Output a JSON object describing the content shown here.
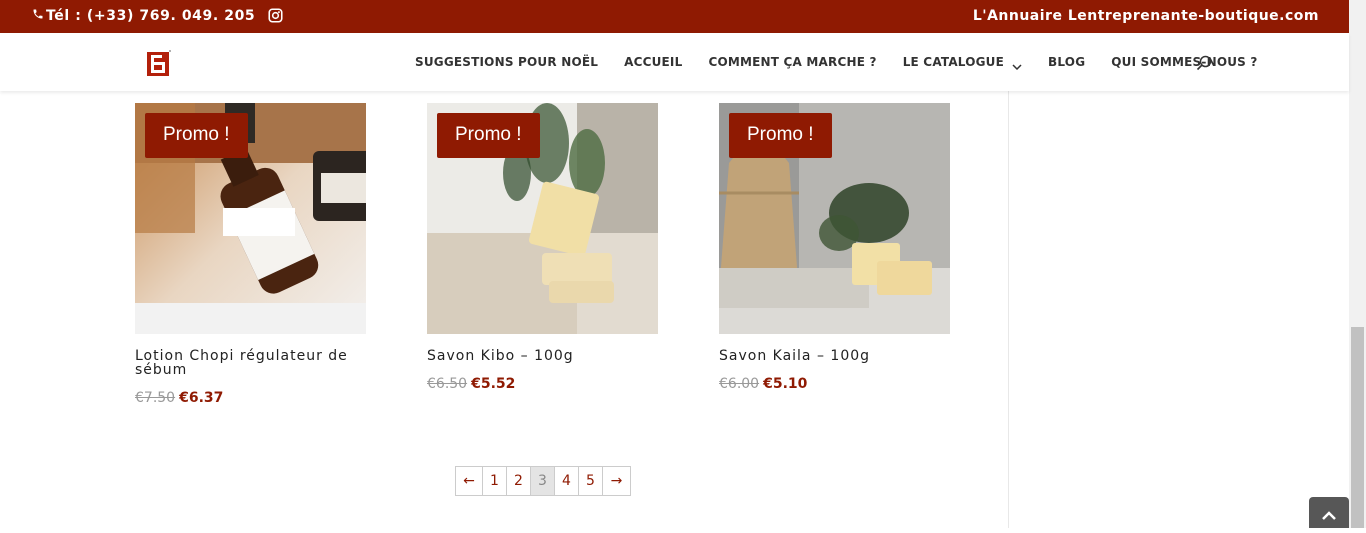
{
  "topbar": {
    "phone": "Tél : (+33) 769. 049. 205",
    "site": "L'Annuaire Lentreprenante-boutique.com",
    "phone_icon": "phone-icon",
    "social_icon": "instagram-icon"
  },
  "nav": {
    "items": [
      {
        "label": "SUGGESTIONS POUR NOËL"
      },
      {
        "label": "ACCUEIL"
      },
      {
        "label": "COMMENT ÇA MARCHE ?"
      },
      {
        "label": "LE CATALOGUE"
      },
      {
        "label": "BLOG"
      },
      {
        "label": "QUI SOMMES-NOUS ?"
      }
    ],
    "search_icon": "search-icon"
  },
  "products": [
    {
      "badge": "Promo !",
      "title": "Lotion Chopi régulateur de sébum",
      "old_price": "€7.50",
      "price": "€6.37"
    },
    {
      "badge": "Promo !",
      "title": "Savon Kibo – 100g",
      "old_price": "€6.50",
      "price": "€5.52"
    },
    {
      "badge": "Promo !",
      "title": "Savon Kaila – 100g",
      "old_price": "€6.00",
      "price": "€5.10"
    }
  ],
  "pagination": {
    "prev": "←",
    "pages": [
      "1",
      "2",
      "3",
      "4",
      "5"
    ],
    "current": "3",
    "next": "→"
  },
  "colors": {
    "brand": "#8f1a02"
  }
}
